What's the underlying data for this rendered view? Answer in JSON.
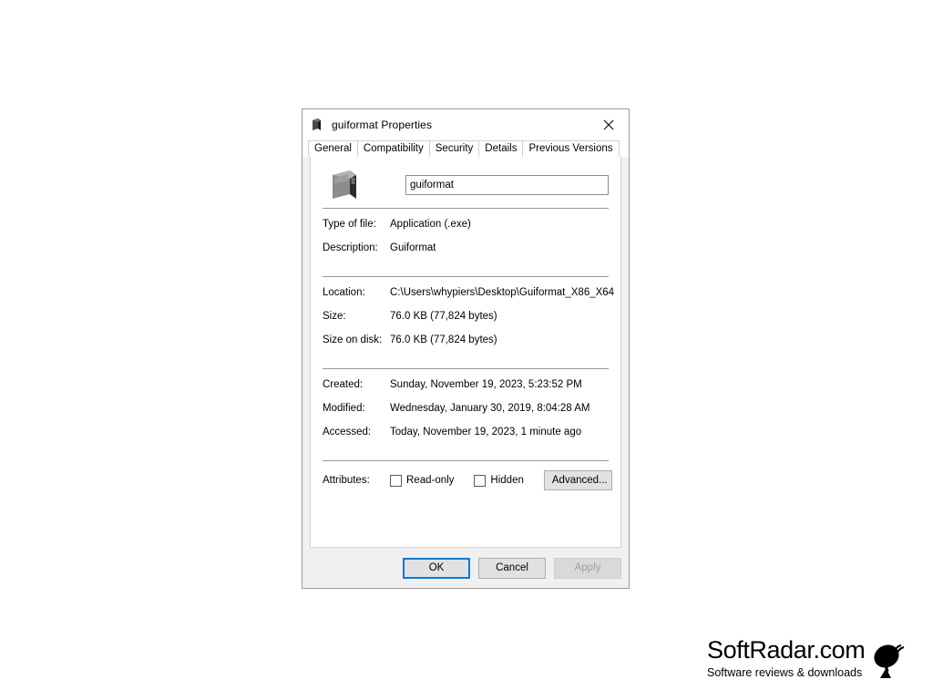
{
  "window": {
    "title": "guiformat Properties",
    "title_icon": "file-exe-icon",
    "close_icon": "close-icon"
  },
  "tabs": [
    {
      "label": "General",
      "active": true
    },
    {
      "label": "Compatibility",
      "active": false
    },
    {
      "label": "Security",
      "active": false
    },
    {
      "label": "Details",
      "active": false
    },
    {
      "label": "Previous Versions",
      "active": false
    }
  ],
  "general": {
    "file_icon": "file-exe-icon",
    "filename_value": "guiformat",
    "filename_placeholder": "File name",
    "details": [
      {
        "label": "Type of file:",
        "value": "Application (.exe)"
      },
      {
        "label": "Description:",
        "value": "Guiformat"
      }
    ],
    "location_group": [
      {
        "label": "Location:",
        "value": "C:\\Users\\whypiers\\Desktop\\Guiformat_X86_X64"
      },
      {
        "label": "Size:",
        "value": "76.0 KB (77,824 bytes)"
      },
      {
        "label": "Size on disk:",
        "value": "76.0 KB (77,824 bytes)"
      }
    ],
    "dates_group": [
      {
        "label": "Created:",
        "value": "Sunday, November 19, 2023, 5:23:52 PM"
      },
      {
        "label": "Modified:",
        "value": "Wednesday, January 30, 2019, 8:04:28 AM"
      },
      {
        "label": "Accessed:",
        "value": "Today, November 19, 2023, 1 minute ago"
      }
    ],
    "attributes": {
      "label": "Attributes:",
      "readonly_label": "Read-only",
      "readonly_checked": false,
      "hidden_label": "Hidden",
      "hidden_checked": false,
      "advanced_label": "Advanced..."
    }
  },
  "footer": {
    "ok_label": "OK",
    "cancel_label": "Cancel",
    "apply_label": "Apply",
    "apply_disabled": true,
    "default_button_accent": "#0078d7"
  },
  "logo": {
    "title": "SoftRadar.com",
    "subtitle": "Software reviews & downloads",
    "icon": "satellite-dish-icon"
  }
}
